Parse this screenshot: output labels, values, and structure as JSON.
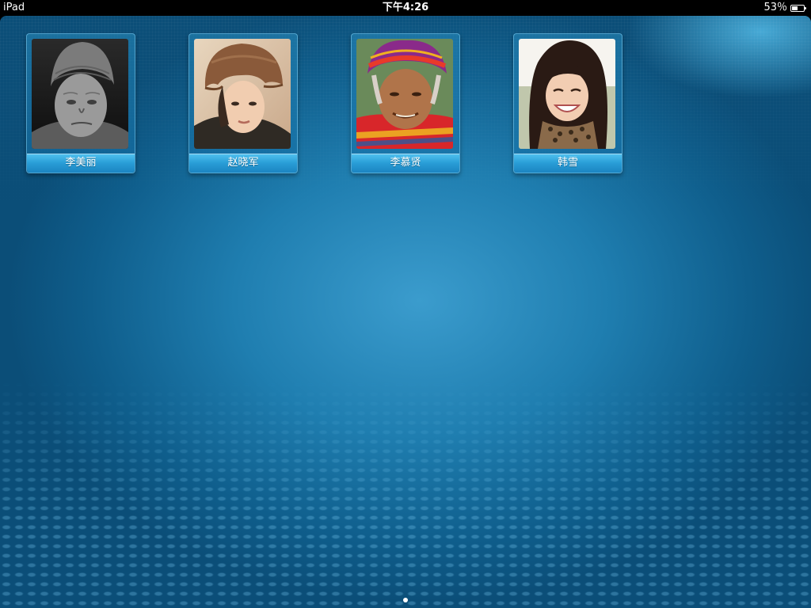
{
  "status_bar": {
    "device": "iPad",
    "time": "下午4:26",
    "battery_percent": "53％",
    "battery_level": 0.53
  },
  "contacts": [
    {
      "name": "李美丽",
      "photo_icon": "portrait-elderly-woman-bw"
    },
    {
      "name": "赵晓军",
      "photo_icon": "portrait-young-woman-fur-hat"
    },
    {
      "name": "李慕贤",
      "photo_icon": "portrait-elderly-woman-headscarf"
    },
    {
      "name": "韩雪",
      "photo_icon": "portrait-smiling-young-woman"
    }
  ],
  "page_indicator": {
    "pages": 1,
    "current": 1
  },
  "colors": {
    "wallpaper_center": "#3b9ccd",
    "wallpaper_edge": "#0b4e78",
    "name_bar": "#2a9fd8"
  }
}
